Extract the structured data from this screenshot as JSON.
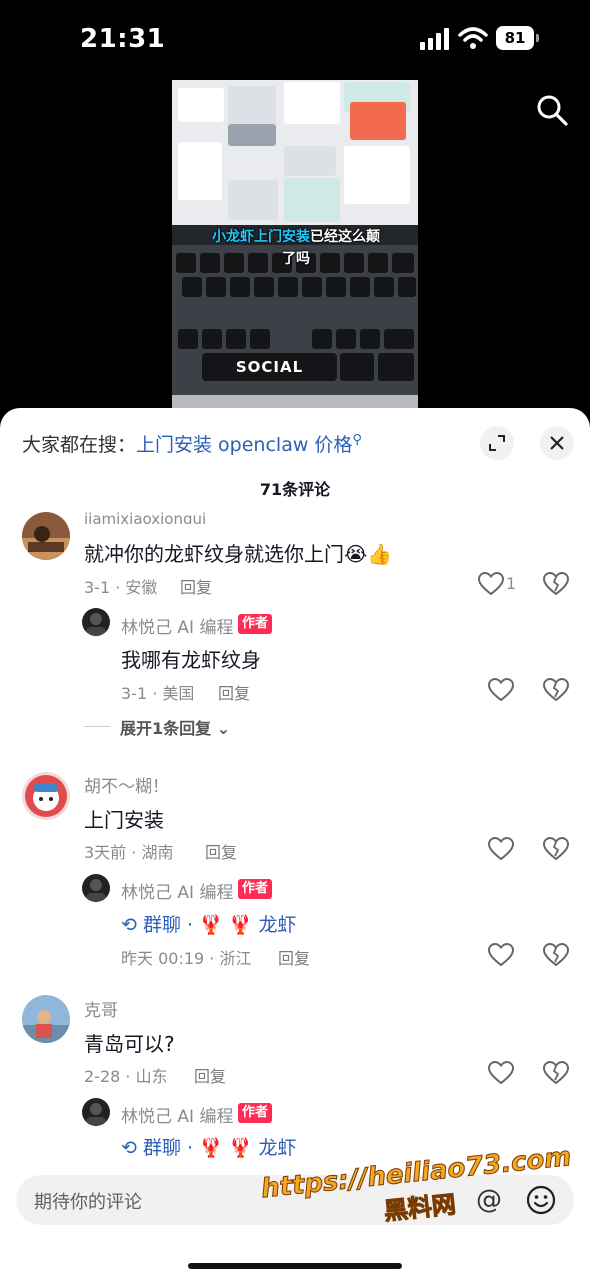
{
  "status_bar": {
    "time": "21:31",
    "battery": "81"
  },
  "video": {
    "caption_highlight": "小龙虾上门安装",
    "caption_rest_line1": "已经这么颠",
    "caption_line2": "了吗",
    "keyboard_key_label": "SOCIAL"
  },
  "sheet": {
    "search_prefix": "大家都在搜：",
    "search_link": "上门安装 openclaw 价格",
    "comment_count": "71条评论"
  },
  "comments": [
    {
      "username": "jiamixiaoxiongui",
      "text": "就冲你的龙虾纹身就选你上门😭👍",
      "meta": "3-1 · 安徽",
      "reply_label": "回复",
      "likes": "1",
      "replies": [
        {
          "username": "林悦己 AI 编程",
          "badge": "作者",
          "text": "我哪有龙虾纹身",
          "meta": "3-1 · 美国",
          "reply_label": "回复"
        }
      ],
      "expand_label": "展开1条回复"
    },
    {
      "username": "胡不～糊！",
      "text": "上门安装",
      "meta": "3天前 · 湖南",
      "reply_label": "回复",
      "replies": [
        {
          "username": "林悦己 AI 编程",
          "badge": "作者",
          "text": "群聊 · 🦞 🦞 龙虾",
          "meta": "昨天 00:19 · 浙江",
          "reply_label": "回复"
        }
      ]
    },
    {
      "username": "克哥",
      "text": "青岛可以?",
      "meta": "2-28 · 山东",
      "reply_label": "回复",
      "replies": [
        {
          "username": "林悦己 AI 编程",
          "badge": "作者",
          "text": "群聊 · 🦞 🦞 龙虾"
        }
      ]
    }
  ],
  "input": {
    "placeholder": "期待你的评论",
    "at_symbol": "@"
  },
  "watermark": {
    "url": "https://heiliao73.com",
    "name": "黑料网"
  },
  "colors": {
    "author_badge": "#fe2c55",
    "link_blue": "#2b5fb8"
  }
}
